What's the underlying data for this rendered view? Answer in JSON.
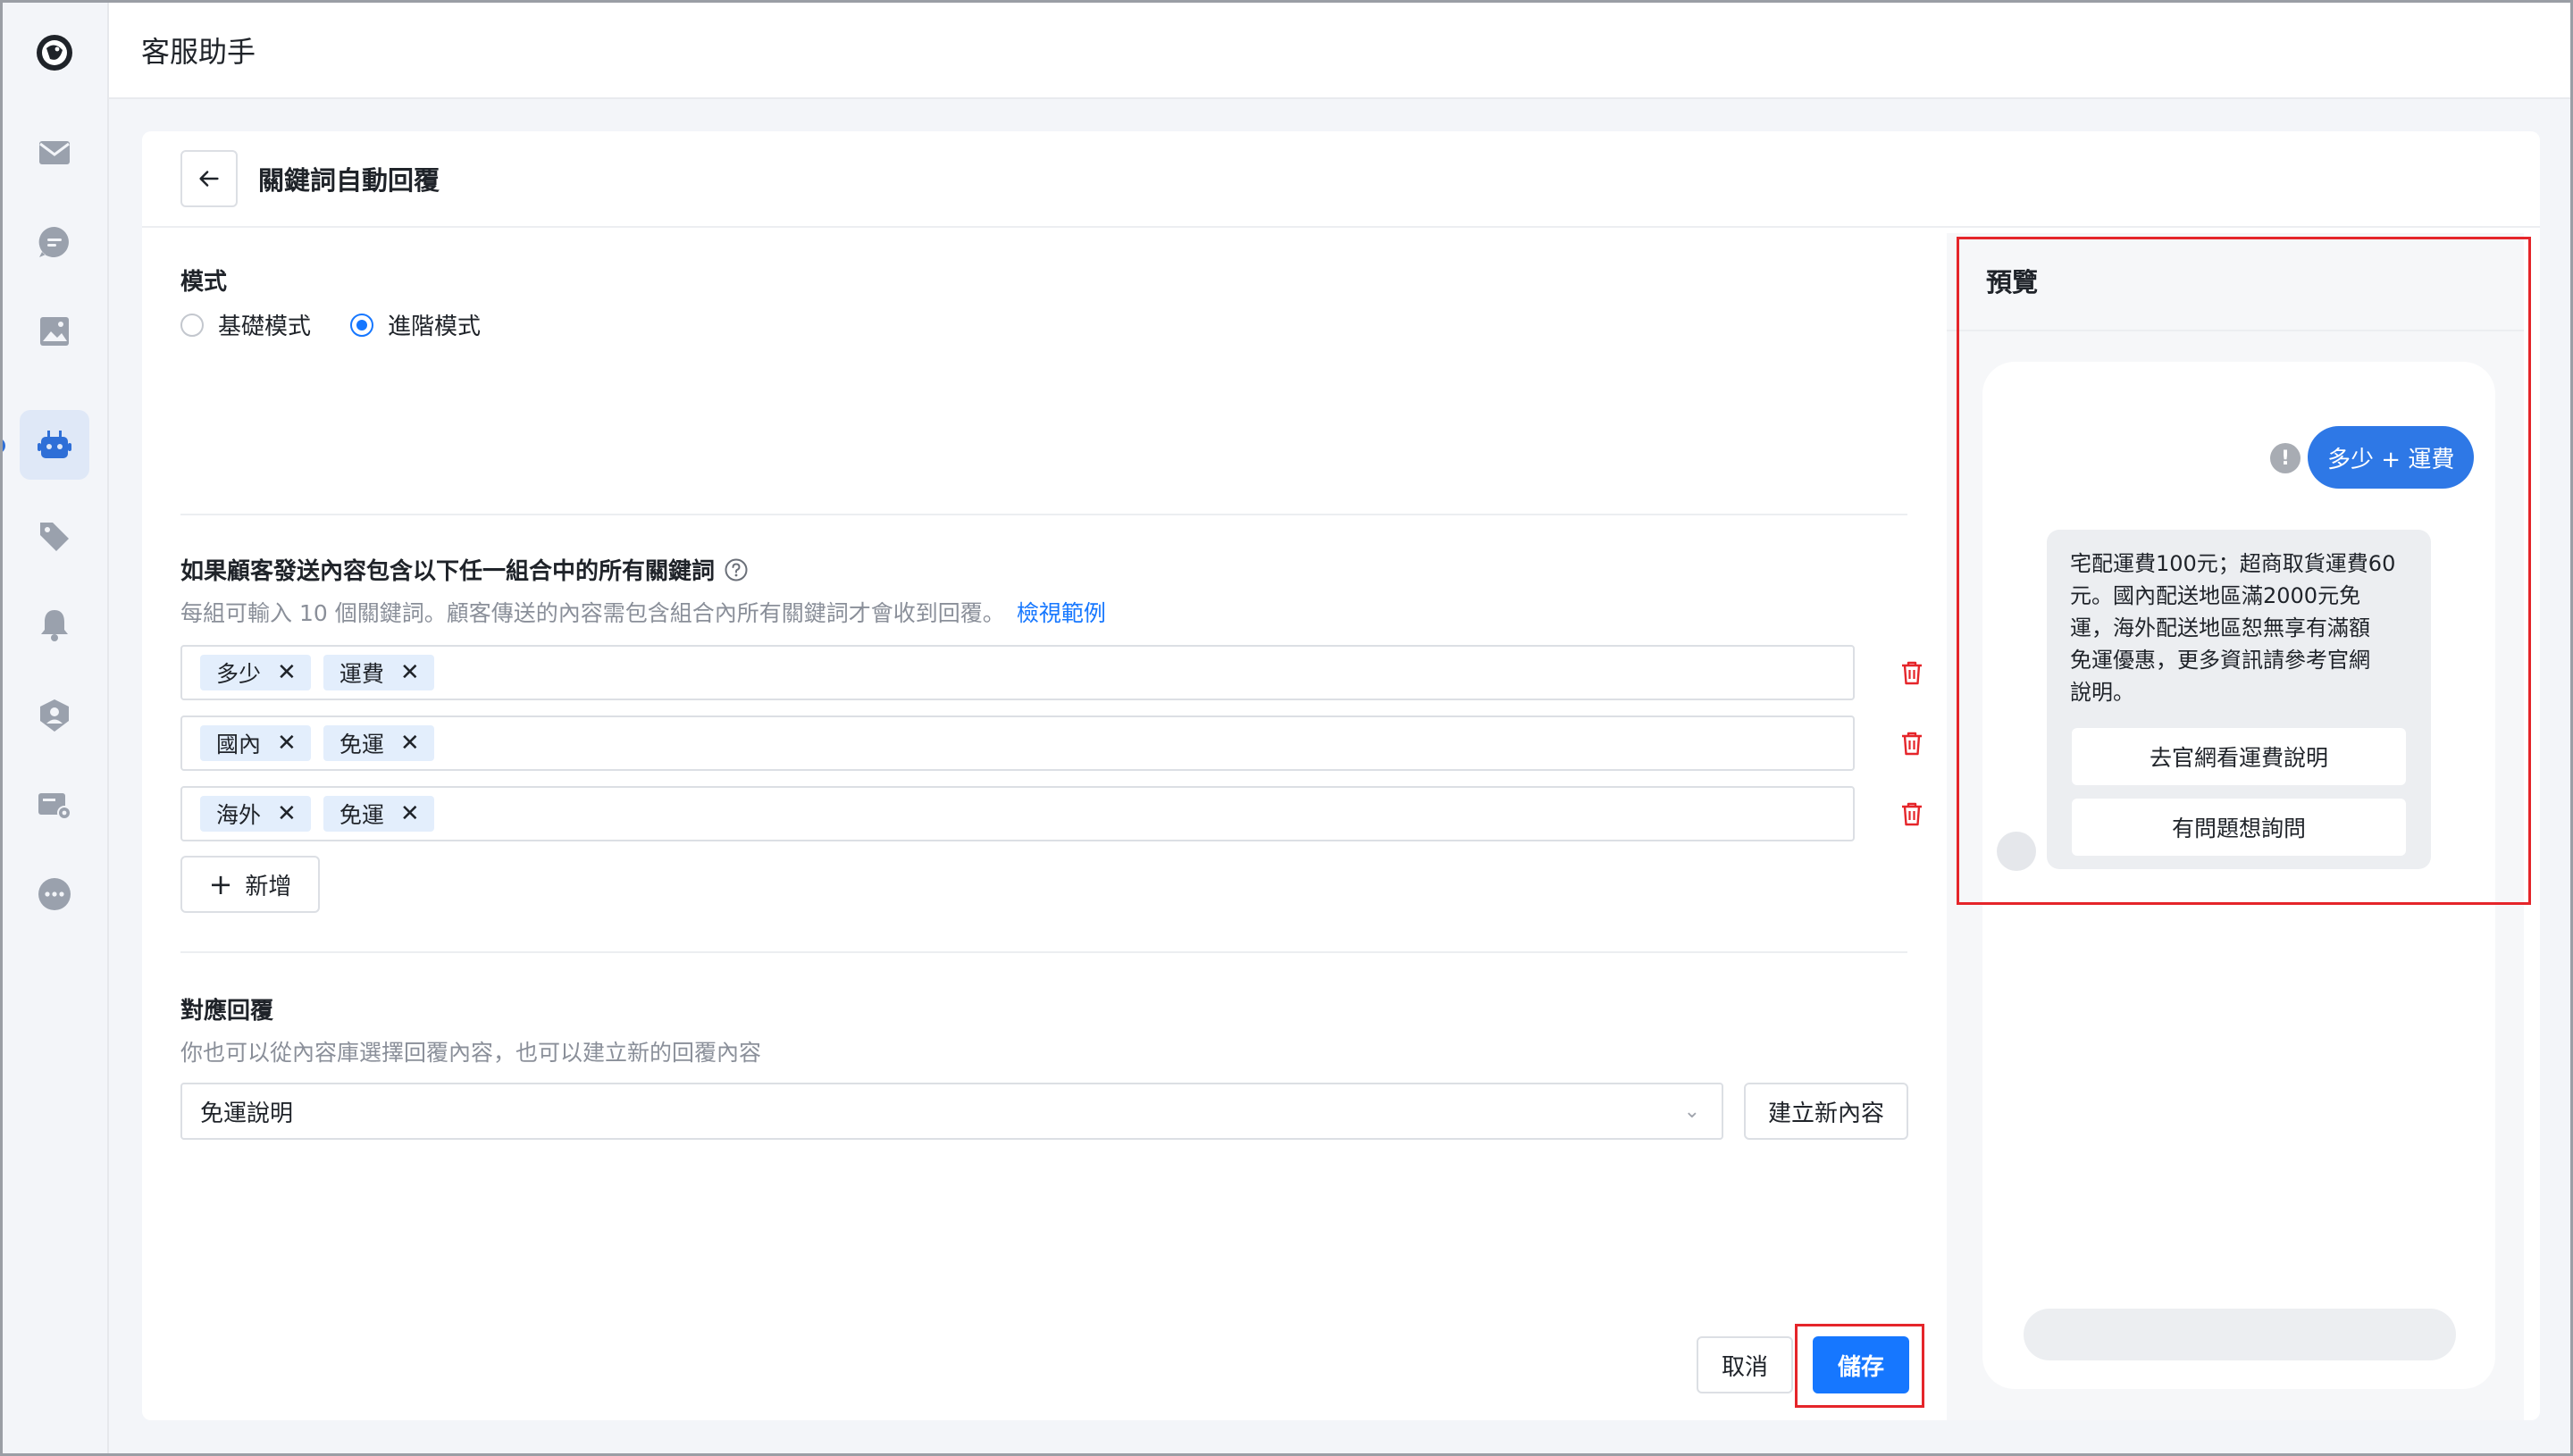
{
  "app": {
    "title": "客服助手"
  },
  "sidebar": {
    "items": [
      {
        "icon": "inbox-icon"
      },
      {
        "icon": "chat-bubble-icon"
      },
      {
        "icon": "image-gallery-icon"
      },
      {
        "icon": "robot-icon",
        "active": true
      },
      {
        "icon": "tag-icon"
      },
      {
        "icon": "bell-icon"
      },
      {
        "icon": "user-shield-icon"
      },
      {
        "icon": "ticket-settings-icon"
      },
      {
        "icon": "more-icon"
      }
    ]
  },
  "page": {
    "title": "關鍵詞自動回覆"
  },
  "mode": {
    "label": "模式",
    "options": [
      {
        "label": "基礎模式",
        "checked": false
      },
      {
        "label": "進階模式",
        "checked": true
      }
    ]
  },
  "keywords": {
    "title": "如果顧客發送內容包含以下任一組合中的所有關鍵詞",
    "hint": "每組可輸入 10 個關鍵詞。顧客傳送的內容需包含組合內所有關鍵詞才會收到回覆。",
    "hint_link": "檢視範例",
    "groups": [
      [
        "多少",
        "運費"
      ],
      [
        "國內",
        "免運"
      ],
      [
        "海外",
        "免運"
      ]
    ],
    "add_label": "新增"
  },
  "reply": {
    "title": "對應回覆",
    "hint": "你也可以從內容庫選擇回覆內容，也可以建立新的回覆內容",
    "selected": "免運說明",
    "create_label": "建立新內容"
  },
  "actions": {
    "cancel": "取消",
    "save": "儲存"
  },
  "preview": {
    "title": "預覽",
    "user_message": "多少 + 運費",
    "bot_message": "宅配運費100元；超商取貨運費60元。國內配送地區滿2000元免運，海外配送地區恕無享有滿額免運優惠，更多資訊請參考官網說明。",
    "bot_lines": [
      "宅配運費100元；超商取貨運費60",
      "元。國內配送地區滿2000元免",
      "運，海外配送地區恕無享有滿額",
      "免運優惠，更多資訊請參考官網",
      "說明。"
    ],
    "quick_replies": [
      "去官網看運費說明",
      "有問題想詢問"
    ]
  },
  "colors": {
    "primary": "#1677ff",
    "user_bubble": "#2e78e6",
    "danger": "#e5252a",
    "tag_bg": "#e3eefc"
  }
}
